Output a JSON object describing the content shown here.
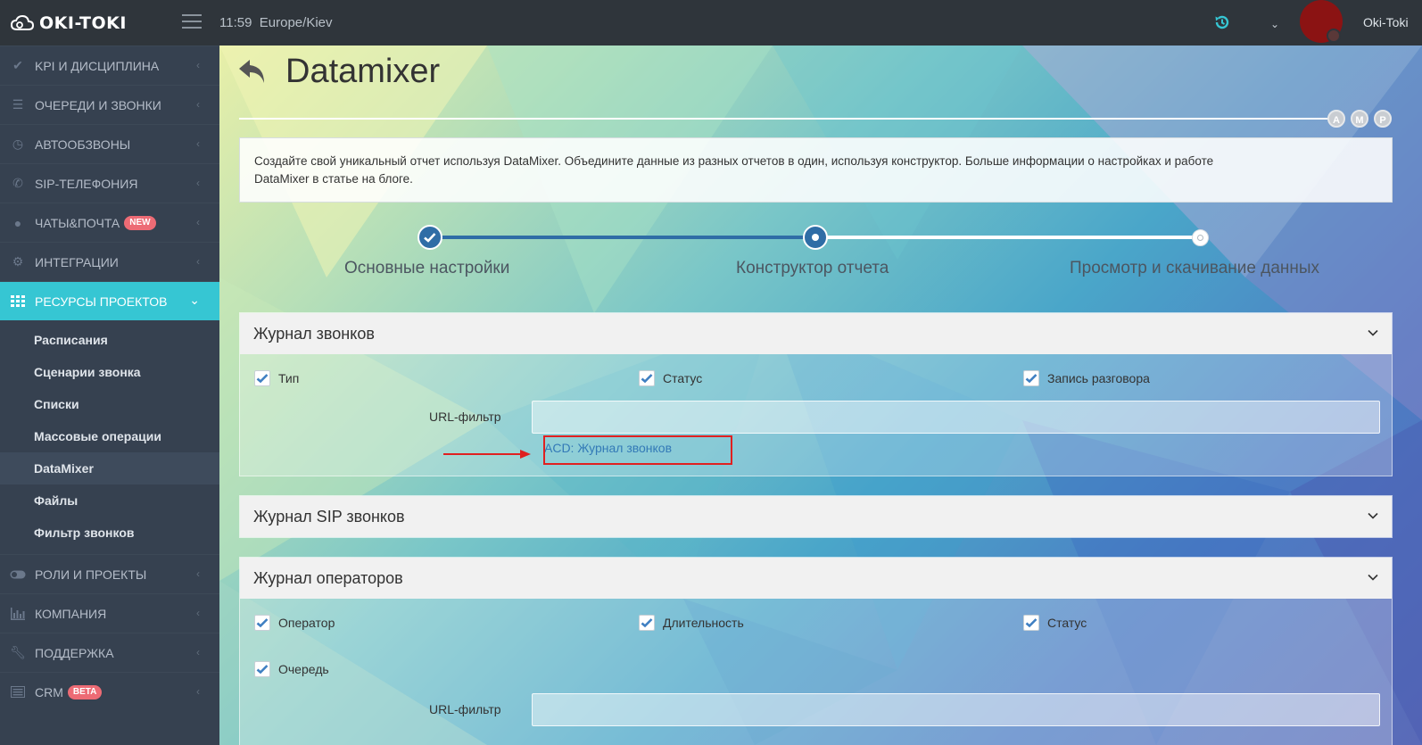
{
  "header": {
    "logo_text": "OKI-TOKI",
    "time": "11:59",
    "timezone": "Europe/Kiev",
    "user_name": "Oki-Toki"
  },
  "sidebar": {
    "items": [
      {
        "label": "KPI И ДИСЦИПЛИНА",
        "icon": "check-icon"
      },
      {
        "label": "ОЧЕРЕДИ И ЗВОНКИ",
        "icon": "list-icon"
      },
      {
        "label": "АВТООБЗВОНЫ",
        "icon": "clock-icon"
      },
      {
        "label": "SIP-ТЕЛЕФОНИЯ",
        "icon": "phone-icon"
      },
      {
        "label": "ЧАТЫ&ПОЧТА",
        "icon": "chat-icon",
        "badge": "NEW"
      },
      {
        "label": "ИНТЕГРАЦИИ",
        "icon": "gears-icon"
      },
      {
        "label": "РЕСУРСЫ ПРОЕКТОВ",
        "icon": "grid-icon"
      }
    ],
    "subitems": [
      "Расписания",
      "Сценарии звонка",
      "Списки",
      "Массовые операции",
      "DataMixer",
      "Файлы",
      "Фильтр звонков"
    ],
    "items_after": [
      {
        "label": "РОЛИ И ПРОЕКТЫ",
        "icon": "toggle-icon"
      },
      {
        "label": "КОМПАНИЯ",
        "icon": "bar-chart-icon"
      },
      {
        "label": "ПОДДЕРЖКА",
        "icon": "wrench-icon"
      },
      {
        "label": "CRM",
        "icon": "card-icon",
        "badge": "BETA"
      }
    ]
  },
  "page": {
    "title": "Datamixer",
    "amp": [
      "A",
      "M",
      "P"
    ],
    "info_line1": "Создайте свой уникальный отчет используя DataMixer. Объедините данные из разных отчетов в один, используя конструктор. Больше информации о настройках и работе",
    "info_line2": "DataMixer в статье на блоге."
  },
  "steps": [
    "Основные настройки",
    "Конструктор отчета",
    "Просмотр и скачивание данных"
  ],
  "panels": {
    "calls": {
      "title": "Журнал звонков",
      "checks": [
        "Тип",
        "Статус",
        "Запись разговора"
      ],
      "url_label": "URL-фильтр",
      "suggestion": "ACD: Журнал звонков"
    },
    "sip": {
      "title": "Журнал SIP звонков"
    },
    "operators": {
      "title": "Журнал операторов",
      "checks": [
        "Оператор",
        "Длительность",
        "Статус",
        "Очередь"
      ],
      "url_label": "URL-фильтр"
    }
  },
  "colors": {
    "sidebar_bg": "#364150",
    "active_item": "#36c6d3",
    "topbar_bg": "#2f353b",
    "step_done": "#2f6da6",
    "highlight": "#e02020"
  }
}
